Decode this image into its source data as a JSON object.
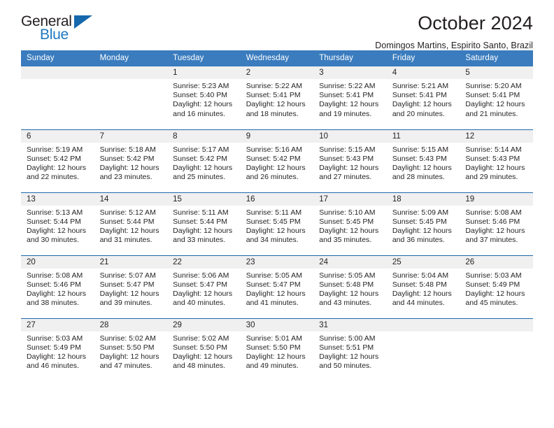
{
  "brand": {
    "name_part1": "General",
    "name_part2": "Blue",
    "triangle_color": "#1668ad",
    "blue_text_color": "#2179c0"
  },
  "header": {
    "title": "October 2024",
    "subtitle": "Domingos Martins, Espirito Santo, Brazil"
  },
  "theme": {
    "header_row_color": "#3a7cbe",
    "row_divider_color": "#1f69ac",
    "daynum_band_color": "#f0f0f0"
  },
  "weekdays": [
    "Sunday",
    "Monday",
    "Tuesday",
    "Wednesday",
    "Thursday",
    "Friday",
    "Saturday"
  ],
  "weeks": [
    [
      {
        "day": "",
        "lines": []
      },
      {
        "day": "",
        "lines": []
      },
      {
        "day": "1",
        "lines": [
          "Sunrise: 5:23 AM",
          "Sunset: 5:40 PM",
          "Daylight: 12 hours",
          "and 16 minutes."
        ]
      },
      {
        "day": "2",
        "lines": [
          "Sunrise: 5:22 AM",
          "Sunset: 5:41 PM",
          "Daylight: 12 hours",
          "and 18 minutes."
        ]
      },
      {
        "day": "3",
        "lines": [
          "Sunrise: 5:22 AM",
          "Sunset: 5:41 PM",
          "Daylight: 12 hours",
          "and 19 minutes."
        ]
      },
      {
        "day": "4",
        "lines": [
          "Sunrise: 5:21 AM",
          "Sunset: 5:41 PM",
          "Daylight: 12 hours",
          "and 20 minutes."
        ]
      },
      {
        "day": "5",
        "lines": [
          "Sunrise: 5:20 AM",
          "Sunset: 5:41 PM",
          "Daylight: 12 hours",
          "and 21 minutes."
        ]
      }
    ],
    [
      {
        "day": "6",
        "lines": [
          "Sunrise: 5:19 AM",
          "Sunset: 5:42 PM",
          "Daylight: 12 hours",
          "and 22 minutes."
        ]
      },
      {
        "day": "7",
        "lines": [
          "Sunrise: 5:18 AM",
          "Sunset: 5:42 PM",
          "Daylight: 12 hours",
          "and 23 minutes."
        ]
      },
      {
        "day": "8",
        "lines": [
          "Sunrise: 5:17 AM",
          "Sunset: 5:42 PM",
          "Daylight: 12 hours",
          "and 25 minutes."
        ]
      },
      {
        "day": "9",
        "lines": [
          "Sunrise: 5:16 AM",
          "Sunset: 5:42 PM",
          "Daylight: 12 hours",
          "and 26 minutes."
        ]
      },
      {
        "day": "10",
        "lines": [
          "Sunrise: 5:15 AM",
          "Sunset: 5:43 PM",
          "Daylight: 12 hours",
          "and 27 minutes."
        ]
      },
      {
        "day": "11",
        "lines": [
          "Sunrise: 5:15 AM",
          "Sunset: 5:43 PM",
          "Daylight: 12 hours",
          "and 28 minutes."
        ]
      },
      {
        "day": "12",
        "lines": [
          "Sunrise: 5:14 AM",
          "Sunset: 5:43 PM",
          "Daylight: 12 hours",
          "and 29 minutes."
        ]
      }
    ],
    [
      {
        "day": "13",
        "lines": [
          "Sunrise: 5:13 AM",
          "Sunset: 5:44 PM",
          "Daylight: 12 hours",
          "and 30 minutes."
        ]
      },
      {
        "day": "14",
        "lines": [
          "Sunrise: 5:12 AM",
          "Sunset: 5:44 PM",
          "Daylight: 12 hours",
          "and 31 minutes."
        ]
      },
      {
        "day": "15",
        "lines": [
          "Sunrise: 5:11 AM",
          "Sunset: 5:44 PM",
          "Daylight: 12 hours",
          "and 33 minutes."
        ]
      },
      {
        "day": "16",
        "lines": [
          "Sunrise: 5:11 AM",
          "Sunset: 5:45 PM",
          "Daylight: 12 hours",
          "and 34 minutes."
        ]
      },
      {
        "day": "17",
        "lines": [
          "Sunrise: 5:10 AM",
          "Sunset: 5:45 PM",
          "Daylight: 12 hours",
          "and 35 minutes."
        ]
      },
      {
        "day": "18",
        "lines": [
          "Sunrise: 5:09 AM",
          "Sunset: 5:45 PM",
          "Daylight: 12 hours",
          "and 36 minutes."
        ]
      },
      {
        "day": "19",
        "lines": [
          "Sunrise: 5:08 AM",
          "Sunset: 5:46 PM",
          "Daylight: 12 hours",
          "and 37 minutes."
        ]
      }
    ],
    [
      {
        "day": "20",
        "lines": [
          "Sunrise: 5:08 AM",
          "Sunset: 5:46 PM",
          "Daylight: 12 hours",
          "and 38 minutes."
        ]
      },
      {
        "day": "21",
        "lines": [
          "Sunrise: 5:07 AM",
          "Sunset: 5:47 PM",
          "Daylight: 12 hours",
          "and 39 minutes."
        ]
      },
      {
        "day": "22",
        "lines": [
          "Sunrise: 5:06 AM",
          "Sunset: 5:47 PM",
          "Daylight: 12 hours",
          "and 40 minutes."
        ]
      },
      {
        "day": "23",
        "lines": [
          "Sunrise: 5:05 AM",
          "Sunset: 5:47 PM",
          "Daylight: 12 hours",
          "and 41 minutes."
        ]
      },
      {
        "day": "24",
        "lines": [
          "Sunrise: 5:05 AM",
          "Sunset: 5:48 PM",
          "Daylight: 12 hours",
          "and 43 minutes."
        ]
      },
      {
        "day": "25",
        "lines": [
          "Sunrise: 5:04 AM",
          "Sunset: 5:48 PM",
          "Daylight: 12 hours",
          "and 44 minutes."
        ]
      },
      {
        "day": "26",
        "lines": [
          "Sunrise: 5:03 AM",
          "Sunset: 5:49 PM",
          "Daylight: 12 hours",
          "and 45 minutes."
        ]
      }
    ],
    [
      {
        "day": "27",
        "lines": [
          "Sunrise: 5:03 AM",
          "Sunset: 5:49 PM",
          "Daylight: 12 hours",
          "and 46 minutes."
        ]
      },
      {
        "day": "28",
        "lines": [
          "Sunrise: 5:02 AM",
          "Sunset: 5:50 PM",
          "Daylight: 12 hours",
          "and 47 minutes."
        ]
      },
      {
        "day": "29",
        "lines": [
          "Sunrise: 5:02 AM",
          "Sunset: 5:50 PM",
          "Daylight: 12 hours",
          "and 48 minutes."
        ]
      },
      {
        "day": "30",
        "lines": [
          "Sunrise: 5:01 AM",
          "Sunset: 5:50 PM",
          "Daylight: 12 hours",
          "and 49 minutes."
        ]
      },
      {
        "day": "31",
        "lines": [
          "Sunrise: 5:00 AM",
          "Sunset: 5:51 PM",
          "Daylight: 12 hours",
          "and 50 minutes."
        ]
      },
      {
        "day": "",
        "lines": []
      },
      {
        "day": "",
        "lines": []
      }
    ]
  ]
}
